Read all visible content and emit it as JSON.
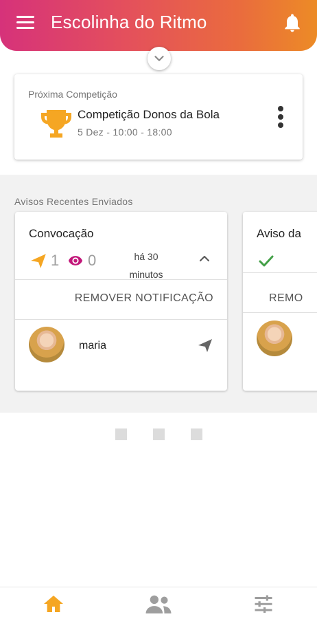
{
  "header": {
    "title": "Escolinha do Ritmo",
    "menu_icon": "hamburger-menu-icon",
    "bell_icon": "bell-icon",
    "gradient": [
      "#d6327a",
      "#ec8b26"
    ]
  },
  "competition": {
    "label": "Próxima Competição",
    "name": "Competição Donos da Bola",
    "date": "5 Dez - 10:00 - 18:00",
    "icon": "trophy-icon",
    "icon_color": "#f5a623"
  },
  "notices": {
    "section_title": "Avisos Recentes Enviados",
    "cards": [
      {
        "title": "Convocação",
        "sent_count": "1",
        "viewed_count": "0",
        "time_line1": "há 30",
        "time_line2": "minutos",
        "remove_label": "REMOVER NOTIFICAÇÃO",
        "recipient": "maria"
      },
      {
        "title": "Aviso da",
        "remove_label": "REMO"
      }
    ]
  },
  "colors": {
    "sent": "#f5a623",
    "viewed": "#c2187a",
    "check": "#43a047",
    "active_nav": "#f5a623",
    "inactive_nav": "#9e9e9e"
  },
  "bottom_nav": [
    {
      "name": "home",
      "icon": "home-icon",
      "active": true
    },
    {
      "name": "people",
      "icon": "people-icon",
      "active": false
    },
    {
      "name": "settings",
      "icon": "sliders-icon",
      "active": false
    }
  ]
}
